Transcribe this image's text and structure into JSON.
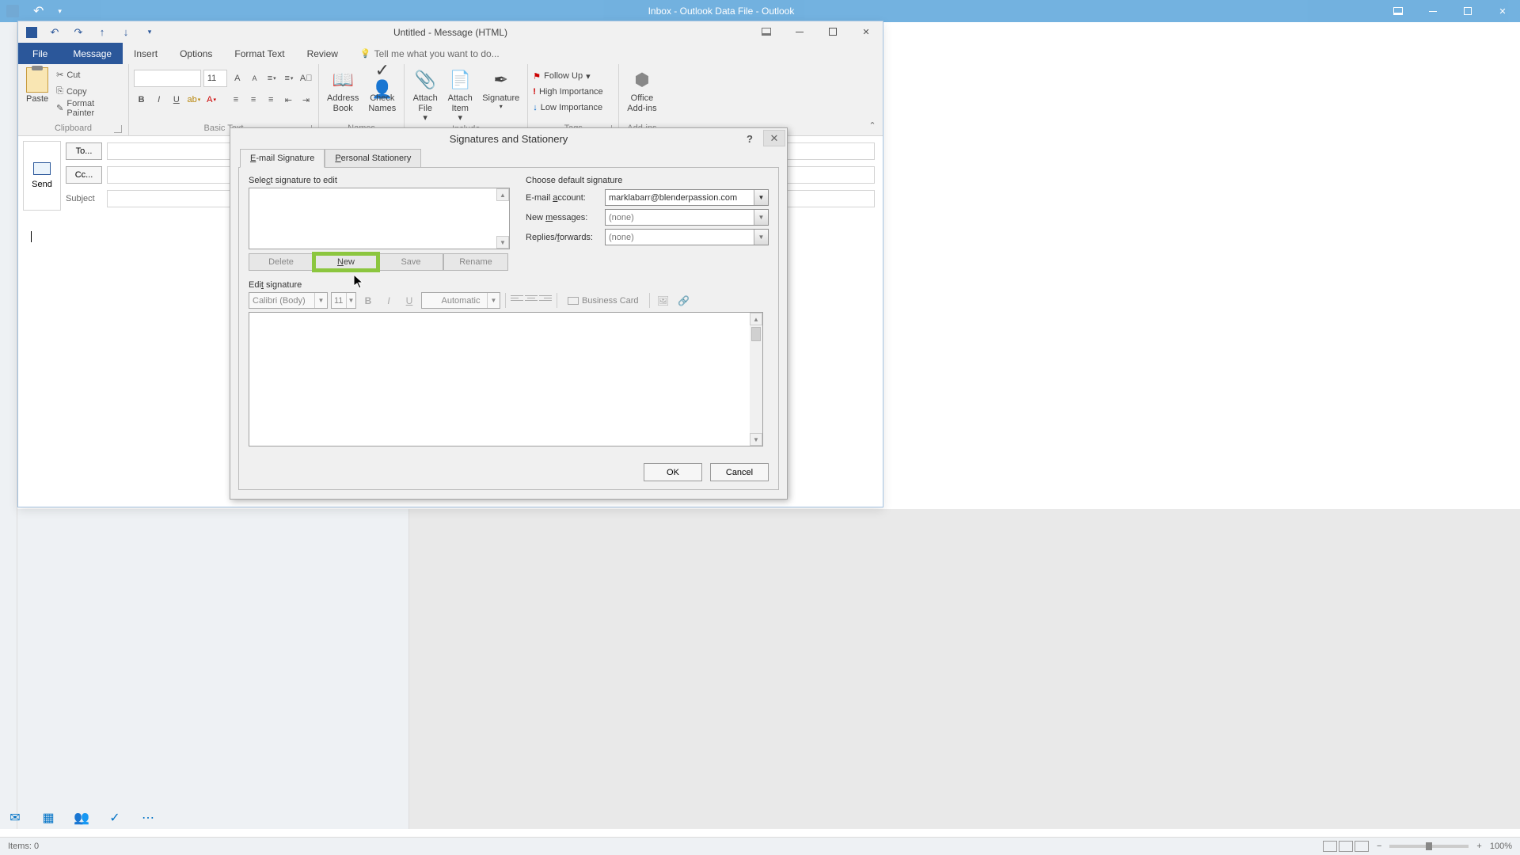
{
  "main_window": {
    "title": "Inbox - Outlook Data File - Outlook"
  },
  "status": {
    "items": "Items: 0",
    "zoom": "100%"
  },
  "msg_window": {
    "title": "Untitled - Message (HTML)",
    "tabs": {
      "file": "File",
      "message": "Message",
      "insert": "Insert",
      "options": "Options",
      "format": "Format Text",
      "review": "Review",
      "tellme": "Tell me what you want to do..."
    },
    "ribbon": {
      "paste": "Paste",
      "cut": "Cut",
      "copy": "Copy",
      "painter": "Format Painter",
      "clipboard": "Clipboard",
      "basic": "Basic Text",
      "names": "Names",
      "include": "Include",
      "tags": "Tags",
      "addins": "Add-ins",
      "address": "Address",
      "book": "Book",
      "check": "Check",
      "names2": "Names",
      "attach_file": "Attach",
      "file": "File",
      "attach_item": "Attach",
      "item": "Item",
      "signature": "Signature",
      "follow": "Follow Up",
      "high": "High Importance",
      "low": "Low Importance",
      "office": "Office",
      "addins2": "Add-ins",
      "font_size": "11"
    },
    "send": "Send",
    "to": "To...",
    "cc": "Cc...",
    "subject": "Subject"
  },
  "dialog": {
    "title": "Signatures and Stationery",
    "tab_email": "E-mail Signature",
    "tab_stat": "Personal Stationery",
    "select": "Select signature to edit",
    "choose": "Choose default signature",
    "lbl_account": "E-mail account:",
    "lbl_new": "New messages:",
    "lbl_reply": "Replies/forwards:",
    "account": "marklabarr@blenderpassion.com",
    "none": "(none)",
    "delete": "Delete",
    "new": "New",
    "save": "Save",
    "rename": "Rename",
    "edit": "Edit signature",
    "font": "Calibri (Body)",
    "fsize": "11",
    "auto": "Automatic",
    "biz": "Business Card",
    "ok": "OK",
    "cancel": "Cancel"
  }
}
